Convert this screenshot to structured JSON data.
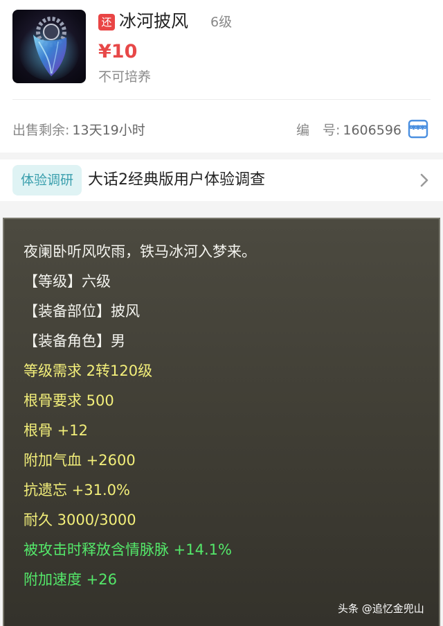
{
  "listing": {
    "badge": "还",
    "name": "冰河披风",
    "level": "6级",
    "price": "¥10",
    "train_status": "不可培养",
    "sale_remaining_label": "出售剩余:",
    "sale_remaining_value": "13天19小时",
    "serial_label": "编　号:",
    "serial_value": "1606596",
    "image_icon": "blue-cape-item-image",
    "shop_icon": "storefront-icon"
  },
  "survey": {
    "tag": "体验调研",
    "text": "大话2经典版用户体验调查",
    "chevron_icon": "chevron-right-icon"
  },
  "item_desc": {
    "lines": [
      {
        "text": "夜阑卧听风吹雨，铁马冰河入梦来。",
        "color": "#f3f3ee"
      },
      {
        "text": "【等级】六级",
        "color": "#f3f3ee"
      },
      {
        "text": "【装备部位】披风",
        "color": "#f3f3ee"
      },
      {
        "text": "【装备角色】男",
        "color": "#f3f3ee"
      },
      {
        "text": "等级需求 2转120级",
        "color": "#f3ef7a"
      },
      {
        "text": "根骨要求 500",
        "color": "#f3ef7a"
      },
      {
        "text": "根骨 +12",
        "color": "#f3ef7a"
      },
      {
        "text": "附加气血 +2600",
        "color": "#f3ef7a"
      },
      {
        "text": "抗遗忘 +31.0%",
        "color": "#f3ef7a"
      },
      {
        "text": "耐久 3000/3000",
        "color": "#f3ef7a"
      },
      {
        "text": "被攻击时释放含情脉脉 +14.1%",
        "color": "#54e86a"
      },
      {
        "text": "附加速度 +26",
        "color": "#54e86a"
      }
    ]
  },
  "watermark": "头条 @追忆金兜山",
  "colors": {
    "price": "#e74848",
    "badge_bg": "#e94545",
    "survey_tag_bg": "#dff3f4",
    "survey_tag_text": "#3a9fad",
    "panel_bg": "#46443a",
    "white_text": "#f3f3ee",
    "yellow_text": "#f3ef7a",
    "green_text": "#54e86a"
  }
}
